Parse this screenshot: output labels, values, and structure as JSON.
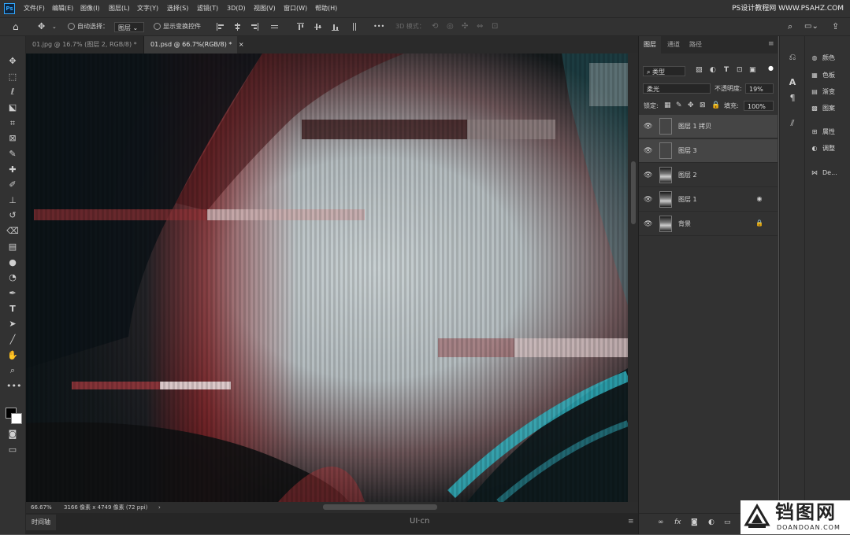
{
  "app": {
    "logo": "Ps",
    "watermark_top": "PS设计教程网 WWW.PSAHZ.COM"
  },
  "menu": [
    "文件(F)",
    "编辑(E)",
    "图像(I)",
    "图层(L)",
    "文字(Y)",
    "选择(S)",
    "滤镜(T)",
    "3D(D)",
    "视图(V)",
    "窗口(W)",
    "帮助(H)"
  ],
  "options": {
    "auto_select_label": "自动选择：",
    "auto_select_value": "图层",
    "show_transform_label": "显示变换控件",
    "more": "•••",
    "mode_3d": "3D 模式："
  },
  "tabs": [
    {
      "label": "01.jpg @ 16.7% (图层 2, RGB/8) *",
      "close": "×"
    },
    {
      "label": "01.psd @ 66.7%(RGB/8) *",
      "close": "×"
    }
  ],
  "status": {
    "zoom": "66.67%",
    "doc_info": "3166 像素 x 4749 像素 (72 ppi)",
    "arrow": "›"
  },
  "timeline": {
    "label": "时间轴"
  },
  "watermark_center": "UI·cn",
  "layers_panel": {
    "tabs": [
      "图层",
      "通道",
      "路径"
    ],
    "filter_kind": "类型",
    "blend_mode": "柔光",
    "opacity_label": "不透明度:",
    "opacity_value": "19%",
    "lock_label": "锁定:",
    "fill_label": "填充:",
    "fill_value": "100%",
    "layers": [
      {
        "name": "图层 1 拷贝",
        "selected": true,
        "thumb": "checker",
        "badge": ""
      },
      {
        "name": "图层 3",
        "selected": true,
        "thumb": "checker",
        "badge": ""
      },
      {
        "name": "图层 2",
        "selected": false,
        "thumb": "photo",
        "badge": ""
      },
      {
        "name": "图层 1",
        "selected": false,
        "thumb": "photo",
        "badge": "◉"
      },
      {
        "name": "背景",
        "selected": false,
        "thumb": "photo",
        "badge": "🔒"
      }
    ],
    "bottom_icons": [
      "link-icon",
      "fx-icon",
      "mask-icon",
      "adjustment-icon",
      "group-icon",
      "new-layer-icon",
      "delete-icon"
    ]
  },
  "right_panel": [
    {
      "icon": "palette-icon",
      "label": "颜色"
    },
    {
      "icon": "swatches-icon",
      "label": "色板"
    },
    {
      "icon": "gradient-icon",
      "label": "渐变"
    },
    {
      "icon": "patterns-icon",
      "label": "图案"
    },
    {
      "icon": "properties-icon",
      "label": "属性"
    },
    {
      "icon": "adjustments-icon",
      "label": "调整"
    },
    {
      "icon": "libraries-icon",
      "label": "De..."
    }
  ],
  "brand": {
    "name": "铛图网",
    "url": "DOANDOAN.COM"
  },
  "colors": {
    "accent": "#31a8ff",
    "chrome": "#323232",
    "canvas_dark": "#1f2a2e"
  }
}
